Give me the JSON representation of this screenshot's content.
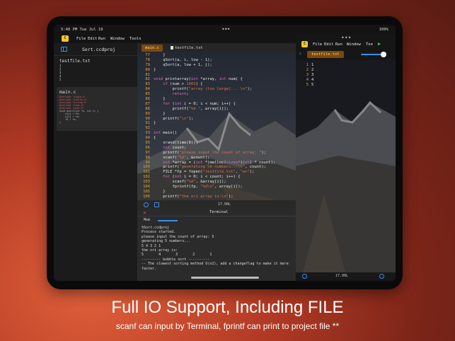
{
  "status": {
    "time": "5:40 PM  Tue Jul 19",
    "right": "100%"
  },
  "menubar": {
    "logo": "C",
    "items": [
      "File",
      "Edit",
      "Run",
      "Window",
      "Tools"
    ]
  },
  "sidebar": {
    "project": "Sort.ccdproj",
    "file_name": "testfile.txt",
    "file_lines": [
      "1",
      "2",
      "3",
      "4",
      "5"
    ],
    "thumb_name": "main.c",
    "thumb_code": [
      {
        "t": "#include \"stdio.h\"",
        "r": true
      },
      {
        "t": "#include \"stdlib.h\"",
        "r": true
      },
      {
        "t": "#include \"string.h\"",
        "r": true
      },
      {
        "t": "#include \"time.h\"",
        "r": true
      },
      {
        "t": "#include \"math.h\"",
        "r": true
      },
      {
        "t": "void qsort(int *a, int n) {",
        "r": false
      },
      {
        "t": "    a[i] = *b;",
        "r": false
      },
      {
        "t": "    a[j] = *a;",
        "r": false
      },
      {
        "t": "    *b = *a;",
        "r": false
      },
      {
        "t": "}",
        "r": false
      }
    ]
  },
  "editor": {
    "tabs": {
      "main": "main.c",
      "test": "testfile.txt"
    },
    "lines": [
      {
        "n": "77",
        "html": "    }"
      },
      {
        "n": "78",
        "html": "    qSort(a, i, low - 1);"
      },
      {
        "n": "79",
        "html": "    qSort(a, low + 1, j);"
      },
      {
        "n": "80",
        "html": "}"
      },
      {
        "n": "81",
        "html": ""
      },
      {
        "n": "82",
        "html": "<span class='kw'>void</span> printarray(<span class='kw'>int</span> *array, <span class='kw'>int</span> num) {"
      },
      {
        "n": "83",
        "html": "    <span class='kw'>if</span> (num &gt; <span class='str'>1001</span>) {"
      },
      {
        "n": "84",
        "html": "        printf(<span class='str'>\"array (too large)... \\n\"</span>);"
      },
      {
        "n": "85",
        "html": "        <span class='kw'>return</span>;"
      },
      {
        "n": "86",
        "html": "    }"
      },
      {
        "n": "87",
        "html": "    <span class='kw'>for</span> (<span class='kw'>int</span> i = 0; i &lt; num; i++) {"
      },
      {
        "n": "88",
        "html": "        printf(<span class='str'>\"%d \"</span>, array[i]);"
      },
      {
        "n": "89",
        "html": "    }"
      },
      {
        "n": "90",
        "html": "    printf(<span class='str'>\"\\n\"</span>);"
      },
      {
        "n": "91",
        "html": "}"
      },
      {
        "n": "92",
        "html": ""
      },
      {
        "n": "93",
        "html": "<span class='kw'>int</span> main()"
      },
      {
        "n": "94",
        "html": "{"
      },
      {
        "n": "95",
        "html": "    srand(time(0));"
      },
      {
        "n": "96",
        "html": "    <span class='kw'>int</span> count;"
      },
      {
        "n": "97",
        "html": "    printf(<span class='str'>\"please input the count of array: \"</span>);"
      },
      {
        "n": "98",
        "html": "    scanf(<span class='str'>\"%d\"</span>, &amp;count);"
      },
      {
        "n": "99",
        "html": "    <span class='kw'>int</span> *array = (<span class='kw'>int</span> *)malloc(<span class='kw'>sizeof</span>(<span class='kw'>int</span>) * count);"
      },
      {
        "n": "100",
        "html": "    printf(<span class='str'>\"generating %d numbers...\\n\"</span>, count);"
      },
      {
        "n": "101",
        "html": "    FILE *fp = fopen(<span class='str'>\"testfile.txt\"</span>, <span class='str'>\"w+\"</span>);"
      },
      {
        "n": "102",
        "html": "    <span class='kw'>for</span> (<span class='kw'>int</span> i = 0; i &lt; count; i++) {"
      },
      {
        "n": "103",
        "html": "        scanf(<span class='str'>\"%d\"</span>, &amp;array[i]);"
      },
      {
        "n": "104",
        "html": "        fprintf(fp, <span class='str'>\"%d\\n\"</span>, array[i]);"
      },
      {
        "n": "105",
        "html": "    }"
      },
      {
        "n": "106",
        "html": "    printf(<span class='str'>\"the ori array is:\\n\"</span>);"
      }
    ],
    "zoom": "17.00L"
  },
  "terminal": {
    "title": "Terminal",
    "subtitle": "Mem",
    "output": "%Sort.ccdproj\nProcess started.\nplease input the count of array: 5\ngenerating 5 numbers...\n5 4 3 2 1\nthe ori array is:\n5       4       3       2       1\n--------- bubble sort ----------\n-- The slowest sorting method O(n2), add a changeflag to make it more\nfaster."
  },
  "rightpanel": {
    "menu_items": [
      "File",
      "Edit",
      "Run",
      "Window",
      "Too"
    ],
    "tab": "testfile.txt",
    "lines": [
      [
        "1",
        "1"
      ],
      [
        "2",
        "2"
      ],
      [
        "3",
        "3"
      ],
      [
        "4",
        "4"
      ],
      [
        "5",
        "5"
      ]
    ],
    "zoom": "17.00L"
  },
  "headline": "Full IO Support, Including FILE",
  "subline": "scanf can input by Terminal, fprintf can print to project file **"
}
